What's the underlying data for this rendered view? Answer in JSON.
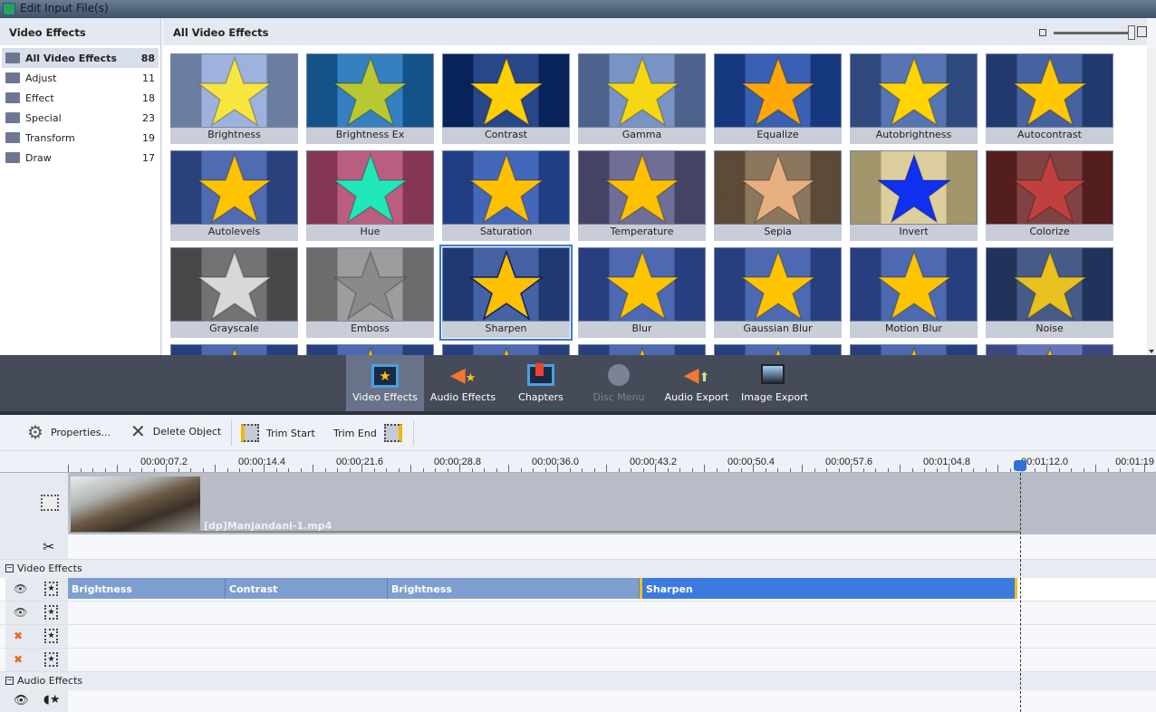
{
  "window": {
    "title": "Edit Input File(s)"
  },
  "left_panel": {
    "title": "Video Effects",
    "categories": [
      {
        "label": "All Video Effects",
        "count": "88"
      },
      {
        "label": "Adjust",
        "count": "11"
      },
      {
        "label": "Effect",
        "count": "18"
      },
      {
        "label": "Special",
        "count": "23"
      },
      {
        "label": "Transform",
        "count": "19"
      },
      {
        "label": "Draw",
        "count": "17"
      }
    ]
  },
  "right_panel": {
    "title": "All Video Effects",
    "effects": [
      {
        "label": "Brightness",
        "bg": "#8fa8d8",
        "star": "#f7e640"
      },
      {
        "label": "Brightness Ex",
        "bg": "#1a6fb8",
        "star": "#b8c830"
      },
      {
        "label": "Contrast",
        "bg": "#0a2e78",
        "star": "#ffd000"
      },
      {
        "label": "Gamma",
        "bg": "#6784bc",
        "star": "#f5d810"
      },
      {
        "label": "Equalize",
        "bg": "#1e4aa8",
        "star": "#ffa808"
      },
      {
        "label": "Autobrightness",
        "bg": "#3f62a8",
        "star": "#ffd400"
      },
      {
        "label": "Autocontrast",
        "bg": "#2c4c94",
        "star": "#ffc800"
      },
      {
        "label": "Autolevels",
        "bg": "#3758a8",
        "star": "#ffc400"
      },
      {
        "label": "Hue",
        "bg": "#b04870",
        "star": "#20e8b8"
      },
      {
        "label": "Saturation",
        "bg": "#2a52b0",
        "star": "#ffc000"
      },
      {
        "label": "Temperature",
        "bg": "#5a5a88",
        "star": "#ffc000"
      },
      {
        "label": "Sepia",
        "bg": "#7a6448",
        "star": "#e8b080"
      },
      {
        "label": "Invert",
        "bg": "#d8c890",
        "star": "#1030f0"
      },
      {
        "label": "Colorize",
        "bg": "#702828",
        "star": "#c04040"
      },
      {
        "label": "Grayscale",
        "bg": "#606060",
        "star": "#d8d8d8"
      },
      {
        "label": "Emboss",
        "bg": "#909090",
        "star": "#8a8a8a"
      },
      {
        "label": "Sharpen",
        "bg": "#2a4c98",
        "star": "#ffc000"
      },
      {
        "label": "Blur",
        "bg": "#3454a8",
        "star": "#ffc400"
      },
      {
        "label": "Gaussian Blur",
        "bg": "#3454a8",
        "star": "#ffc400"
      },
      {
        "label": "Motion Blur",
        "bg": "#3454a8",
        "star": "#ffc400"
      },
      {
        "label": "Noise",
        "bg": "#2c4478",
        "star": "#e8c020"
      }
    ],
    "selected": "Sharpen"
  },
  "modes": [
    {
      "label": "Video Effects",
      "icon": "video-effects-icon",
      "active": true
    },
    {
      "label": "Audio Effects",
      "icon": "audio-effects-icon"
    },
    {
      "label": "Chapters",
      "icon": "chapters-icon"
    },
    {
      "label": "Disc Menu",
      "icon": "disc-menu-icon",
      "disabled": true
    },
    {
      "label": "Audio Export",
      "icon": "audio-export-icon"
    },
    {
      "label": "Image Export",
      "icon": "image-export-icon"
    }
  ],
  "toolbar": {
    "properties": "Properties...",
    "delete": "Delete Object",
    "trim_start": "Trim Start",
    "trim_end": "Trim End"
  },
  "ruler": [
    "00:00:07.2",
    "00:00:14.4",
    "00:00:21.6",
    "00:00:28.8",
    "00:00:36.0",
    "00:00:43.2",
    "00:00:50.4",
    "00:00:57.6",
    "00:01:04.8",
    "00:01:12.0",
    "00:01:19"
  ],
  "timeline": {
    "clip": "[dp]Manjandani-1.mp4",
    "video_effects_label": "Video Effects",
    "audio_effects_label": "Audio Effects",
    "effect_blocks": [
      {
        "label": "Brightness"
      },
      {
        "label": "Contrast"
      },
      {
        "label": "Brightness"
      },
      {
        "label": "Sharpen",
        "selected": true
      }
    ]
  }
}
